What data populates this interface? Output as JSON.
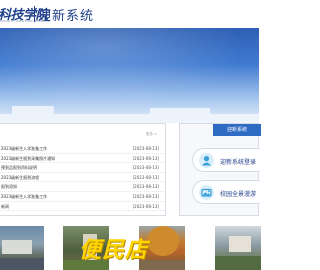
{
  "header": {
    "logo_cn": "科技学院",
    "logo_en": "SCHOOL OF SCIENCE AND TECHNOLOGY",
    "system_title": "迎新系统"
  },
  "news": {
    "more_label": "更多 >",
    "items": [
      {
        "title": "2023级新生入学准备工作",
        "date": "[2023-08-13]"
      },
      {
        "title": "2023级新生报到采集照片通知",
        "date": "[2023-08-13]"
      },
      {
        "title": "预到品报到资料说明",
        "date": "[2023-08-13]"
      },
      {
        "title": "2023级新生报到流程",
        "date": "[2023-08-13]"
      },
      {
        "title": "报到须知",
        "date": "[2023-08-13]"
      },
      {
        "title": "2023级新生入学准备工作",
        "date": "[2023-08-13]"
      },
      {
        "title": "新闻",
        "date": "[2023-08-13]"
      }
    ]
  },
  "side": {
    "heading": "迎新系统",
    "login_label": "迎新系统登录",
    "tour_label": "校园全景漫游",
    "login_icon": "user-icon",
    "tour_icon": "panorama-icon"
  },
  "photos": {
    "watermark": "便民店"
  },
  "colors": {
    "brand": "#1f3f8a",
    "accent": "#2e6bc2",
    "watermark": "#ffd400"
  }
}
